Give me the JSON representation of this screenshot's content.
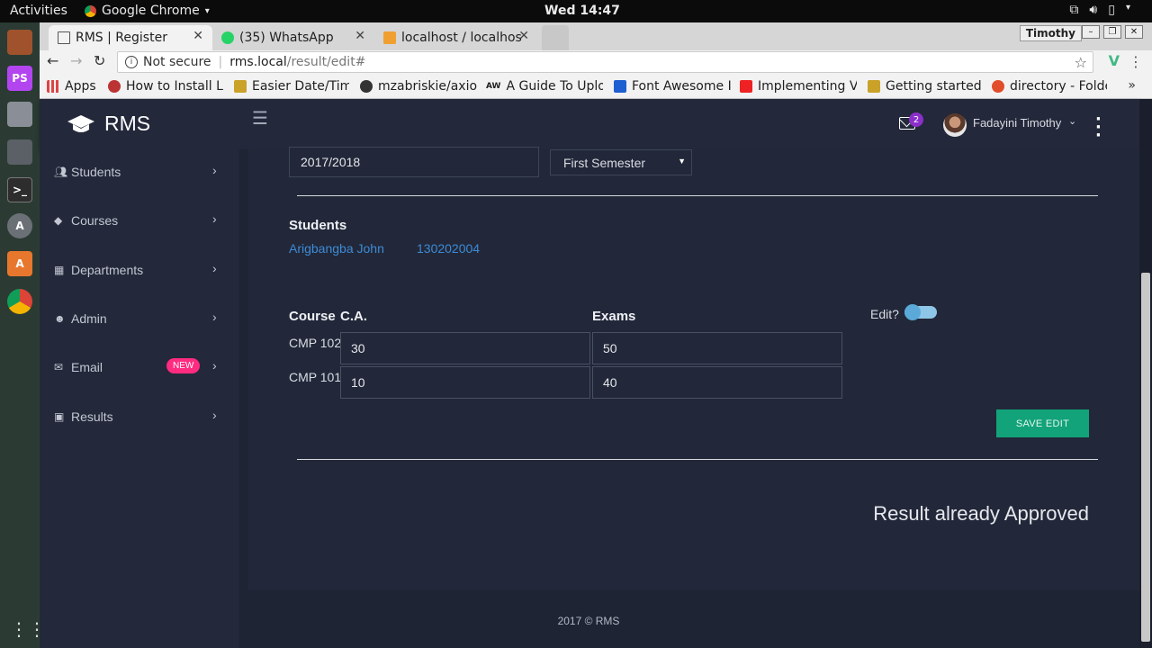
{
  "os": {
    "activities": "Activities",
    "app_name": "Google Chrome",
    "clock": "Wed 14:47"
  },
  "browser": {
    "tabs": [
      {
        "label": "RMS | Register"
      },
      {
        "label": "(35) WhatsApp"
      },
      {
        "label": "localhost / localhos"
      }
    ],
    "profile": "Timothy",
    "url": {
      "security": "Not secure",
      "host": "rms.local",
      "path": "/result/edit#"
    },
    "bookmarks": [
      {
        "label": "Apps"
      },
      {
        "label": "How to Install La"
      },
      {
        "label": "Easier Date/Tim"
      },
      {
        "label": "mzabriskie/axio"
      },
      {
        "label": "A Guide To Uplo"
      },
      {
        "label": "Font Awesome I"
      },
      {
        "label": "Implementing V"
      },
      {
        "label": "Getting started v"
      },
      {
        "label": "directory - Folde"
      }
    ],
    "more": "»"
  },
  "app": {
    "brand": "RMS",
    "header": {
      "mail_count": "2",
      "user_name": "Fadayini Timothy"
    },
    "sidebar": [
      {
        "label": "Students"
      },
      {
        "label": "Courses"
      },
      {
        "label": "Departments"
      },
      {
        "label": "Admin"
      },
      {
        "label": "Email",
        "badge": "NEW"
      },
      {
        "label": "Results"
      }
    ],
    "form": {
      "session": "2017/2018",
      "semester": "First Semester",
      "students_heading": "Students",
      "student_name": "Arigbangba John",
      "student_id": "130202004",
      "col_course": "Course",
      "col_ca": "C.A.",
      "col_exams": "Exams",
      "edit_label": "Edit?",
      "rows": [
        {
          "course": "CMP 102",
          "ca": "30",
          "exam": "50"
        },
        {
          "course": "CMP 101",
          "ca": "10",
          "exam": "40"
        }
      ],
      "save_label": "SAVE EDIT",
      "status": "Result already Approved"
    },
    "footer": "2017 © RMS"
  },
  "colors": {
    "accent_green": "#12a37a",
    "link_blue": "#3e8ad6",
    "badge_pink": "#ff2b80",
    "mail_badge_purple": "#8b2fc9",
    "panel_bg": "#23283a"
  }
}
